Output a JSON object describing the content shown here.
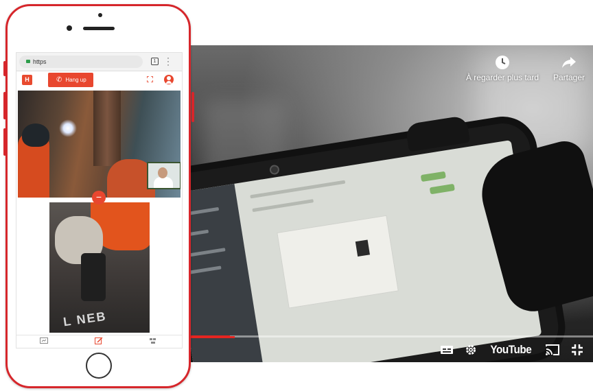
{
  "player": {
    "watch_later_label": "À regarder plus tard",
    "share_label": "Partager",
    "youtube_label": "YouTube",
    "progress_fraction": 0.1,
    "accent_color": "#e52521"
  },
  "phone": {
    "browser": {
      "url_text": "https"
    },
    "app": {
      "logo_text": "H",
      "hangup_label": "Hang up",
      "accent_color": "#e8472f"
    },
    "video_bottom": {
      "chalk_text": "L NEB"
    }
  },
  "icons": {
    "player": [
      "clock-icon",
      "share-arrow-icon",
      "captions-icon",
      "settings-gear-icon",
      "cast-icon",
      "exit-fullscreen-icon"
    ],
    "phone": [
      "lock-icon",
      "tabs-icon",
      "menu-dots-icon",
      "phone-icon",
      "fullscreen-icon",
      "user-icon",
      "minus-icon",
      "screen-icon",
      "annotate-icon",
      "parts-icon"
    ]
  }
}
